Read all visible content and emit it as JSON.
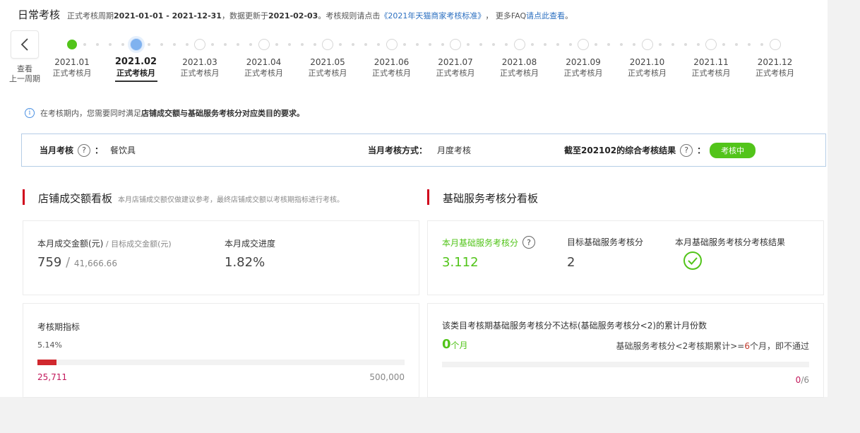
{
  "header": {
    "title": "日常考核",
    "period_prefix": "正式考核周期",
    "period": "2021-01-01 - 2021-12-31",
    "update_prefix": "，数据更新于",
    "update_date": "2021-02-03",
    "rule_prefix": "。考核规则请点击",
    "rule_link": "《2021年天猫商家考核标准》",
    "faq_prefix": "， 更多FAQ",
    "faq_link": "请点此查看",
    "faq_suffix": "。"
  },
  "timeline": {
    "prev_label_1": "查看",
    "prev_label_2": "上一周期",
    "months": [
      {
        "year": "2021.01",
        "status": "正式考核月",
        "state": "done"
      },
      {
        "year": "2021.02",
        "status": "正式考核月",
        "state": "current"
      },
      {
        "year": "2021.03",
        "status": "正式考核月",
        "state": "future"
      },
      {
        "year": "2021.04",
        "status": "正式考核月",
        "state": "future"
      },
      {
        "year": "2021.05",
        "status": "正式考核月",
        "state": "future"
      },
      {
        "year": "2021.06",
        "status": "正式考核月",
        "state": "future"
      },
      {
        "year": "2021.07",
        "status": "正式考核月",
        "state": "future"
      },
      {
        "year": "2021.08",
        "status": "正式考核月",
        "state": "future"
      },
      {
        "year": "2021.09",
        "status": "正式考核月",
        "state": "future"
      },
      {
        "year": "2021.10",
        "status": "正式考核月",
        "state": "future"
      },
      {
        "year": "2021.11",
        "status": "正式考核月",
        "state": "future"
      },
      {
        "year": "2021.12",
        "status": "正式考核月",
        "state": "future"
      }
    ]
  },
  "notice": {
    "prefix": "在考核期内，您需要同时满足",
    "bold": "店铺成交额与基础服务考核分对应类目的要求。"
  },
  "summary": {
    "current_label": "当月考核",
    "current_colon": "：",
    "current_value": "餐饮具",
    "method_label": "当月考核方式：",
    "method_value": "月度考核",
    "result_label": "截至202102的综合考核结果",
    "result_colon": "：",
    "result_badge": "考核中"
  },
  "sales_board": {
    "title": "店铺成交额看板",
    "desc": "本月店铺成交额仅做建议参考，最终店铺成交额以考核期指标进行考核。",
    "amount_label": "本月成交金额(元)",
    "target_label": " / 目标成交金额(元)",
    "amount_value": "759",
    "target_value": " / ",
    "target_num": "41,666.66",
    "progress_label": "本月成交进度",
    "progress_value": "1.82%",
    "period_label": "考核期指标",
    "period_percent": "5.14%",
    "period_progress": 0.0514,
    "period_current": "25,711",
    "period_target": "500,000"
  },
  "service_board": {
    "title": "基础服务考核分看板",
    "score_label": "本月基础服务考核分",
    "score_value": "3.112",
    "target_label": "目标基础服务考核分",
    "target_value": "2",
    "result_label": "本月基础服务考核分考核结果",
    "fail_title": "该类目考核期基础服务考核分不达标(基础服务考核分<2)的累计月份数",
    "fail_count": "0",
    "fail_unit": "个月",
    "rule_text_1": "基础服务考核分<2考核期累计>=",
    "rule_num": "6",
    "rule_text_2": "个月，即不通过",
    "fail_progress": 0,
    "fail_ratio_num": "0",
    "fail_ratio_den": "/6"
  },
  "colors": {
    "accent_green": "#52c41a",
    "accent_red": "#d0021b",
    "link_blue": "#2b6fc0"
  }
}
